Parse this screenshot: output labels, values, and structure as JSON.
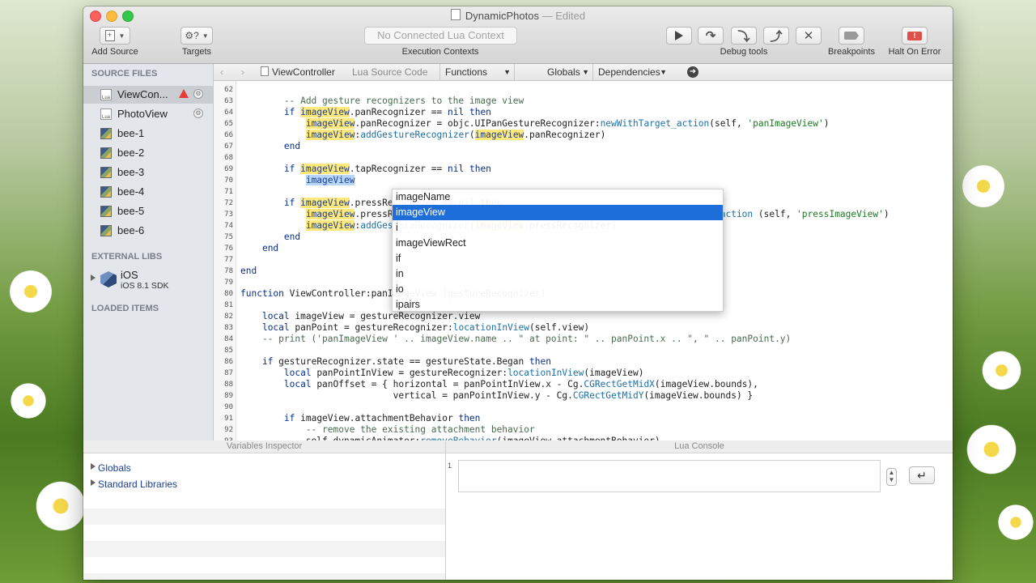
{
  "window": {
    "title": "DynamicPhotos",
    "status": "Edited"
  },
  "toolbar": {
    "add_source_label": "Add Source",
    "targets_label": "Targets",
    "lua_context_value": "No Connected Lua Context",
    "execution_contexts_label": "Execution Contexts",
    "debug_tools_label": "Debug tools",
    "breakpoints_label": "Breakpoints",
    "halt_on_error_label": "Halt On Error",
    "targets_glyph": "⚙?"
  },
  "sidebar": {
    "source_files_header": "SOURCE FILES",
    "files": [
      {
        "label": "ViewCon...",
        "icon": "lua-file-icon",
        "selected": true
      },
      {
        "label": "PhotoView",
        "icon": "lua-file-icon"
      },
      {
        "label": "bee-1",
        "icon": "image-file-icon"
      },
      {
        "label": "bee-2",
        "icon": "image-file-icon"
      },
      {
        "label": "bee-3",
        "icon": "image-file-icon"
      },
      {
        "label": "bee-4",
        "icon": "image-file-icon"
      },
      {
        "label": "bee-5",
        "icon": "image-file-icon"
      },
      {
        "label": "bee-6",
        "icon": "image-file-icon"
      }
    ],
    "external_libs_header": "EXTERNAL LIBS",
    "ios_label": "iOS",
    "ios_sub": "iOS 8.1 SDK",
    "loaded_items_header": "LOADED ITEMS"
  },
  "navbar": {
    "file_label": "ViewController",
    "source_label": "Lua Source Code",
    "functions_label": "Functions",
    "globals_label": "Globals",
    "dependencies_label": "Dependencies"
  },
  "editor": {
    "line_numbers": [
      "62",
      "63",
      "64",
      "65",
      "66",
      "67",
      "68",
      "69",
      "70",
      "71",
      "72",
      "73",
      "74",
      "75",
      "76",
      "77",
      "78",
      "79",
      "80",
      "81",
      "82",
      "83",
      "84",
      "85",
      "86",
      "87",
      "88",
      "89",
      "90",
      "91",
      "92",
      "93"
    ],
    "lines": [
      "",
      "        -- Add gesture recognizers to the image view",
      "        if imageView.panRecognizer == nil then",
      "            imageView.panRecognizer = objc.UIPanGestureRecognizer:newWithTarget_action(self, 'panImageView')",
      "            imageView:addGestureRecognizer(imageView.panRecognizer)",
      "        end",
      "",
      "        if imageView.tapRecognizer == nil then",
      "            imageView",
      "",
      "        if imageView.pressRecognizer == nil then",
      "            imageView.pressRecognizer = objc.UILongPressGestureRecognizer:newWithTarget_action (self, 'pressImageView')",
      "            imageView:addGestureRecognizer(imageView.pressRecognizer)",
      "        end",
      "    end",
      "",
      "end",
      "",
      "function ViewController:panImageView (gestureRecognizer)",
      "",
      "    local imageView = gestureRecognizer.view",
      "    local panPoint = gestureRecognizer:locationInView(self.view)",
      "    -- print ('panImageView ' .. imageView.name .. \" at point: \" .. panPoint.x .. \", \" .. panPoint.y)",
      "",
      "    if gestureRecognizer.state == gestureState.Began then",
      "        local panPointInView = gestureRecognizer:locationInView(imageView)",
      "        local panOffset = { horizontal = panPointInView.x - Cg.CGRectGetMidX(imageView.bounds),",
      "                            vertical = panPointInView.y - Cg.CGRectGetMidY(imageView.bounds) }",
      "",
      "        if imageView.attachmentBehavior then",
      "            -- remove the existing attachment behavior",
      "            self.dynamicAnimator:removeBehavior(imageView.attachmentBehavior)"
    ]
  },
  "autocomplete": {
    "items": [
      "imageName",
      "imageView",
      "i",
      "imageViewRect",
      "if",
      "in",
      "io",
      "ipairs"
    ],
    "selected_index": 1
  },
  "bottom": {
    "variables_inspector_title": "Variables Inspector",
    "lua_console_title": "Lua Console",
    "globals_label": "Globals",
    "standard_libraries_label": "Standard Libraries",
    "console_line_number": "1",
    "return_glyph": "↵"
  }
}
